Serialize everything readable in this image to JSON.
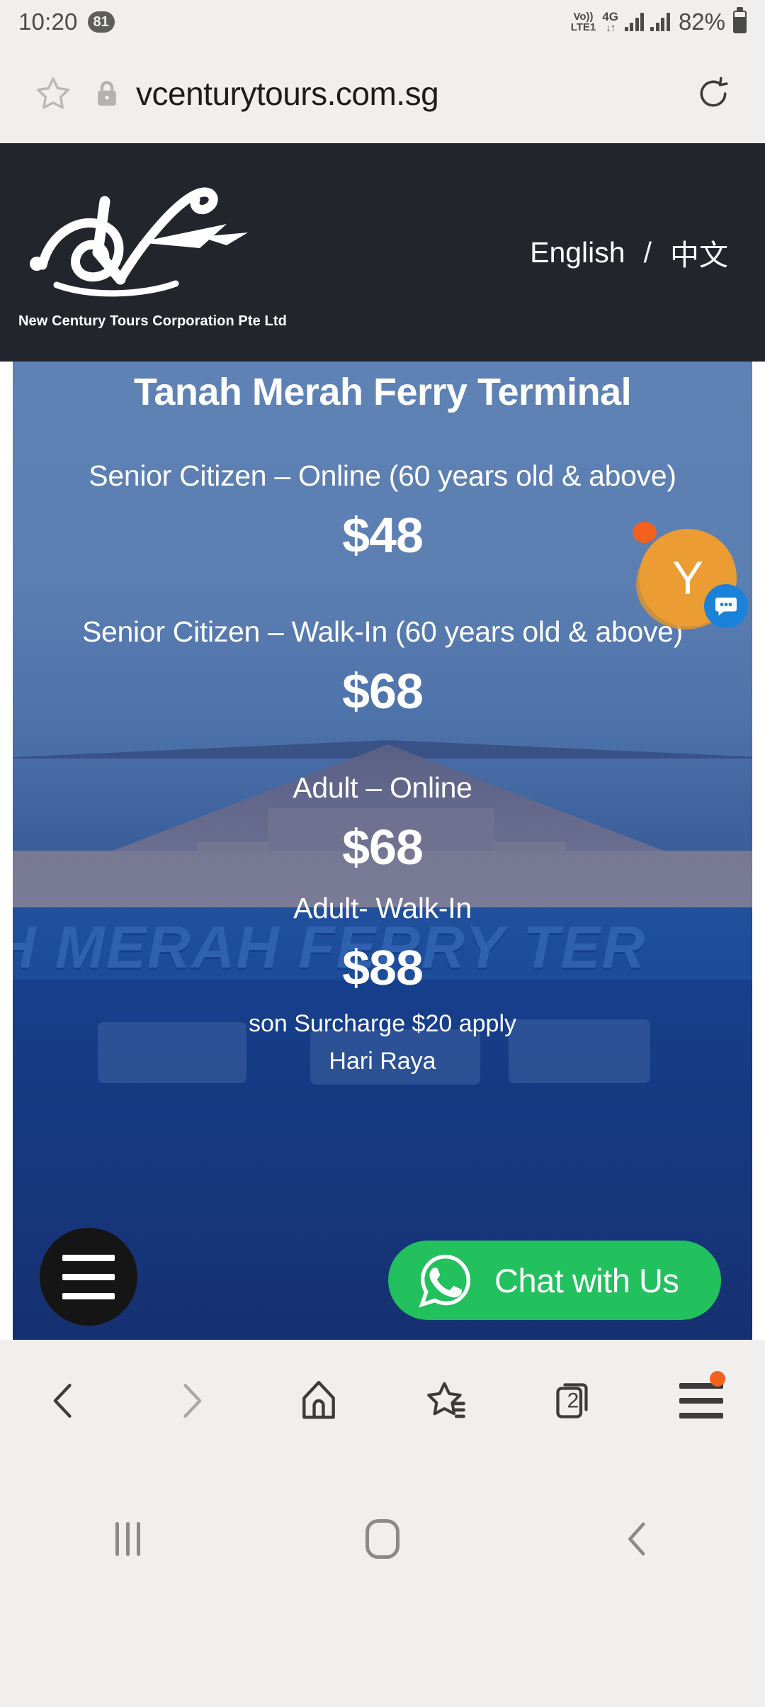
{
  "status_bar": {
    "time": "10:20",
    "notification_count": "81",
    "volte_top": "Vo))",
    "volte_bottom": "LTE1",
    "network_type": "4G",
    "data_arrows": "↓↑",
    "battery_percent": "82%",
    "icons": [
      "volte-icon",
      "4g-icon",
      "signal-bars-icon",
      "signal-bars-icon",
      "battery-icon"
    ]
  },
  "browser": {
    "url": "vcenturytours.com.sg",
    "bookmark_icon": "star-icon",
    "security_icon": "lock-icon",
    "reload_icon": "reload-icon",
    "bottom_nav": {
      "back_label": "back-icon",
      "forward_label": "forward-icon",
      "home_label": "home-icon",
      "bookmarks_label": "bookmarks-star-icon",
      "tabs_count": "2",
      "menu_label": "hamburger-menu-icon",
      "menu_has_notification": true
    }
  },
  "site_header": {
    "logo_icon": "new-century-tours-logo",
    "brand_name": "New Century Tours Corporation Pte Ltd",
    "languages": {
      "english": "English",
      "separator": "/",
      "chinese": "中文"
    },
    "background_color": "#22262c"
  },
  "hero": {
    "title": "Tanah Merah Ferry Terminal",
    "background_sign_text": "H MERAH FERRY TER",
    "fares": [
      {
        "label": "Senior Citizen – Online (60 years old & above)",
        "price": "$48"
      },
      {
        "label": "Senior Citizen – Walk-In (60 years old & above)",
        "price": "$68"
      },
      {
        "label": "Adult – Online",
        "price": "$68"
      },
      {
        "label": "Adult- Walk-In",
        "price": "$88"
      }
    ],
    "notes_line1": "son Surcharge $20 apply",
    "notes_line2": "Hari Raya"
  },
  "widgets": {
    "chat_avatar": {
      "initial": "Y",
      "avatar_color": "#eb9c33",
      "badge_color": "#1b82d9",
      "badge_icon": "chat-bubble-icon",
      "dot_color": "#f4601e"
    },
    "whatsapp_button": {
      "label": "Chat with Us",
      "icon": "whatsapp-icon",
      "color": "#22c15e"
    },
    "fab_menu": {
      "icon": "hamburger-menu-icon",
      "color": "#151515"
    }
  },
  "system_nav": {
    "recents": "recents-icon",
    "home": "home-icon",
    "back": "back-icon"
  }
}
